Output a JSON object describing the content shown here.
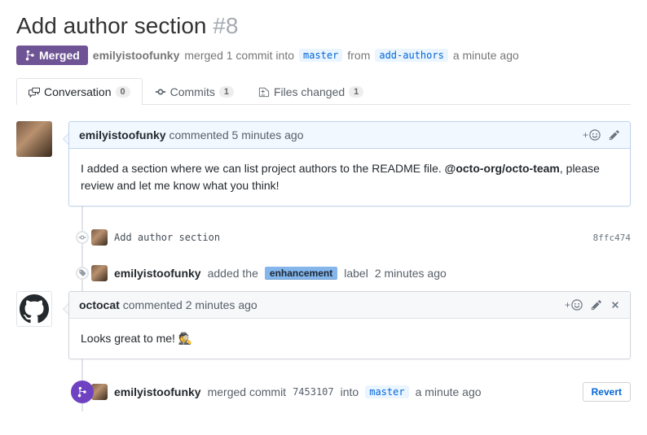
{
  "title": "Add author section",
  "issue_number": "#8",
  "state_label": "Merged",
  "meta": {
    "actor": "emilyistoofunky",
    "action_text": "merged 1 commit into",
    "base_branch": "master",
    "from_word": "from",
    "head_branch": "add-authors",
    "timestamp": "a minute ago"
  },
  "tabs": {
    "conversation": {
      "label": "Conversation",
      "count": "0"
    },
    "commits": {
      "label": "Commits",
      "count": "1"
    },
    "files": {
      "label": "Files changed",
      "count": "1"
    }
  },
  "comment1": {
    "author": "emilyistoofunky",
    "verb": "commented",
    "timestamp": "5 minutes ago",
    "body_pre": "I added a section where we can list project authors to the README file. ",
    "mention": "@octo-org/octo-team",
    "body_post": ", please review and let me know what you think!"
  },
  "commit_event": {
    "message": "Add author section",
    "sha": "8ffc474"
  },
  "label_event": {
    "actor": "emilyistoofunky",
    "action_pre": "added the",
    "label_name": "enhancement",
    "action_post": "label",
    "timestamp": "2 minutes ago"
  },
  "comment2": {
    "author": "octocat",
    "verb": "commented",
    "timestamp": "2 minutes ago",
    "body": "Looks great to me! ",
    "emoji": "🕵️"
  },
  "merged_event": {
    "actor": "emilyistoofunky",
    "action_pre": "merged commit",
    "sha": "7453107",
    "into_word": "into",
    "target_branch": "master",
    "timestamp": "a minute ago",
    "revert_label": "Revert"
  }
}
